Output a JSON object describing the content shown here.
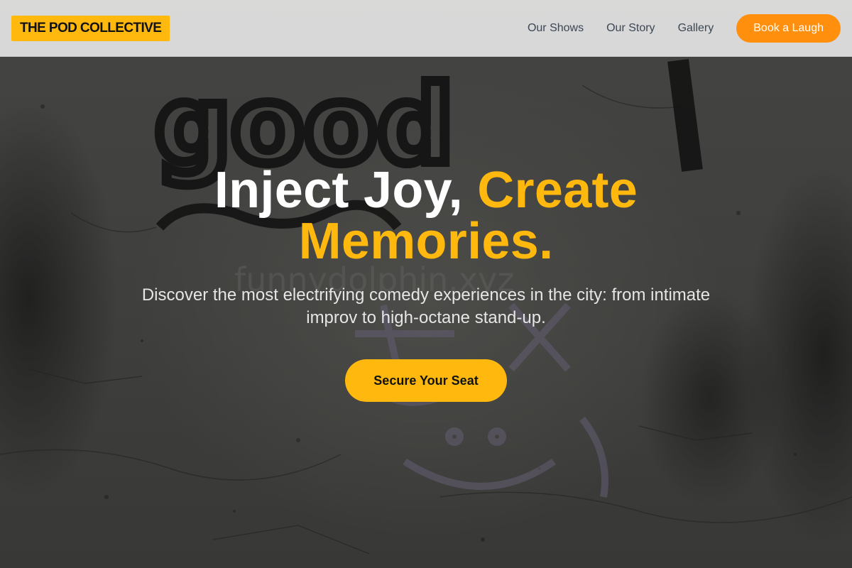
{
  "brand": {
    "logo_text": "THE POD COLLECTIVE"
  },
  "nav": {
    "links": [
      {
        "label": "Our Shows"
      },
      {
        "label": "Our Story"
      },
      {
        "label": "Gallery"
      }
    ],
    "cta_label": "Book a Laugh"
  },
  "hero": {
    "headline_part1": "Inject Joy, ",
    "headline_accent": "Create Memories.",
    "subheading": "Discover the most electrifying comedy experiences in the city: from intimate improv to high-octane stand-up.",
    "cta_label": "Secure Your Seat",
    "background_graffiti_text": "good",
    "background_watermark_text": "funnydolphin.xyz"
  },
  "colors": {
    "accent": "#ffb80d",
    "nav_cta": "#ff8f0d",
    "nav_text": "#3c4654",
    "navbar_bg": "#e4e4e4"
  },
  "icons": {
    "background_drawing": "smiley-face-graffiti"
  }
}
